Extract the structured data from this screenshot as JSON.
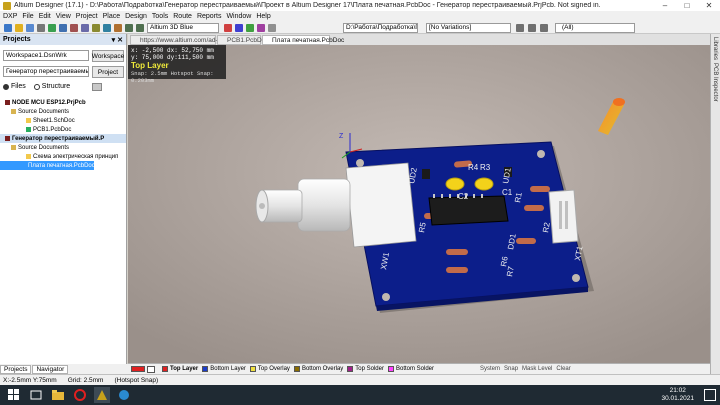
{
  "window": {
    "title": "Altium Designer (17.1) - D:\\Работа\\Подработка\\Генератор перестраиваемый\\Проект в Altium Designer 17\\Плата печатная.PcbDoc - Генератор перестраиваемый.PrjPcb. Not signed in.",
    "min": "–",
    "max": "□",
    "close": "✕"
  },
  "menu": [
    "DXP",
    "File",
    "Edit",
    "View",
    "Project",
    "Place",
    "Design",
    "Tools",
    "Route",
    "Reports",
    "Window",
    "Help"
  ],
  "toolbar": {
    "path": "D:\\Работа\\Подработка\\Ге",
    "variations": "[No Variations]",
    "filter": "(All)",
    "view_mode": "Altium 3D Blue"
  },
  "projects_panel": {
    "title": "Projects",
    "workspace": "Workspace1.DsnWrk",
    "workspace_btn": "Workspace",
    "project": "Генератор перестраиваемый.PrjPc",
    "project_btn": "Project",
    "radio_files": "Files",
    "radio_structure": "Structure",
    "tree": [
      {
        "label": "NODE MCU ESP12.PrjPcb",
        "level": 0,
        "style": "bold",
        "color": "#7a1e1e"
      },
      {
        "label": "Source Documents",
        "level": 1,
        "style": "",
        "color": "#d8b450"
      },
      {
        "label": "Sheet1.SchDoc",
        "level": 2,
        "style": "",
        "color": "#f2c94c"
      },
      {
        "label": "PCB1.PcbDoc",
        "level": 2,
        "style": "",
        "color": "#27ae60"
      },
      {
        "label": "Генератор перестраиваемый.P",
        "level": 0,
        "style": "hl",
        "color": "#7a1e1e"
      },
      {
        "label": "Source Documents",
        "level": 1,
        "style": "",
        "color": "#d8b450"
      },
      {
        "label": "Схема электрическая принцип",
        "level": 2,
        "style": "",
        "color": "#f2c94c"
      },
      {
        "label": "Плата печатная.PcbDoc",
        "level": 2,
        "style": "sel",
        "color": "#27ae60"
      }
    ],
    "footer_tabs": [
      "Projects",
      "Navigator"
    ]
  },
  "doc_tabs": [
    {
      "label": "https://www.altium.com/ad-start",
      "active": false
    },
    {
      "label": "PCB1.PcbDoc",
      "active": false
    },
    {
      "label": "Плата печатная.PcbDoc",
      "active": true
    }
  ],
  "hud": {
    "line1": "x: -2,500   dx: 52,750  mm",
    "line2": "y: 75,000   dy:111,500  mm",
    "layer": "Top Layer",
    "snap": "Snap: 2.5mm Hotspot Snap: 0.203mm"
  },
  "board": {
    "components": [
      "R4",
      "R3",
      "C1",
      "C2",
      "UD2",
      "UD1",
      "R5",
      "R1",
      "R2",
      "DD1",
      "R6",
      "R7",
      "XW1",
      "XT1"
    ],
    "axis_z": "Z"
  },
  "layers": [
    {
      "name": "Top Layer",
      "color": "#e02020",
      "bold": true
    },
    {
      "name": "Bottom Layer",
      "color": "#1a3cc9",
      "bold": false
    },
    {
      "name": "Top Overlay",
      "color": "#f0e040",
      "bold": false
    },
    {
      "name": "Bottom Overlay",
      "color": "#8a6c00",
      "bold": false
    },
    {
      "name": "Top Solder",
      "color": "#a0208a",
      "bold": false
    },
    {
      "name": "Bottom Solder",
      "color": "#ff40ff",
      "bold": false
    }
  ],
  "layer_extra": [
    "System",
    "Snap",
    "Mask Level",
    "Clear"
  ],
  "right_strip": [
    "Libraries",
    "PCB Inspector"
  ],
  "status": {
    "coords": "X:-2.5mm Y:75mm",
    "grid": "Grid: 2.5mm",
    "snap": "(Hotspot Snap)"
  },
  "taskbar": {
    "time": "21:02",
    "date": "30.01.2021"
  }
}
